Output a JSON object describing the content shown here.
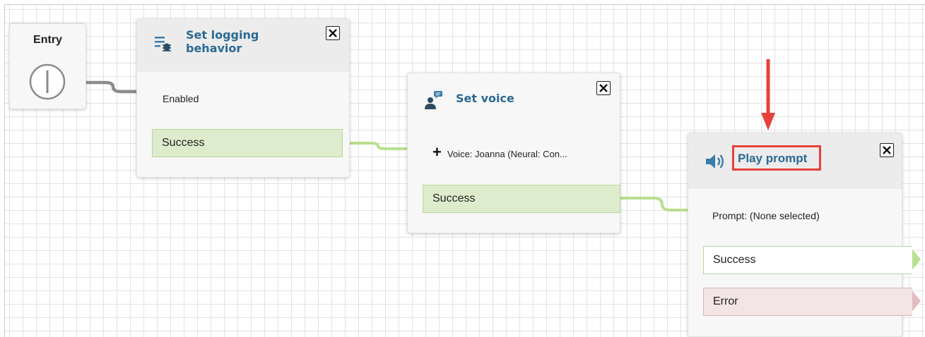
{
  "entry": {
    "label": "Entry"
  },
  "blocks": [
    {
      "id": "set-logging",
      "title_line1": "Set logging",
      "title_line2": "behavior",
      "icon": "logging-icon",
      "param": "Enabled",
      "branches": [
        "Success"
      ]
    },
    {
      "id": "set-voice",
      "title": "Set voice",
      "icon": "voice-person-icon",
      "param": "Voice: Joanna (Neural: Con...",
      "expand_symbol": "+",
      "branches": [
        "Success"
      ]
    },
    {
      "id": "play-prompt",
      "title": "Play prompt",
      "icon": "speaker-icon",
      "param": "Prompt: (None selected)",
      "branches": [
        "Success",
        "Error"
      ]
    }
  ],
  "colors": {
    "title_blue": "#2a6a94",
    "success_fill": "#ddeccc",
    "success_wire": "#b9df8f",
    "error_fill": "#f3e4e6",
    "highlight_red": "#e8403a",
    "entry_wire": "#8a8a8a"
  }
}
